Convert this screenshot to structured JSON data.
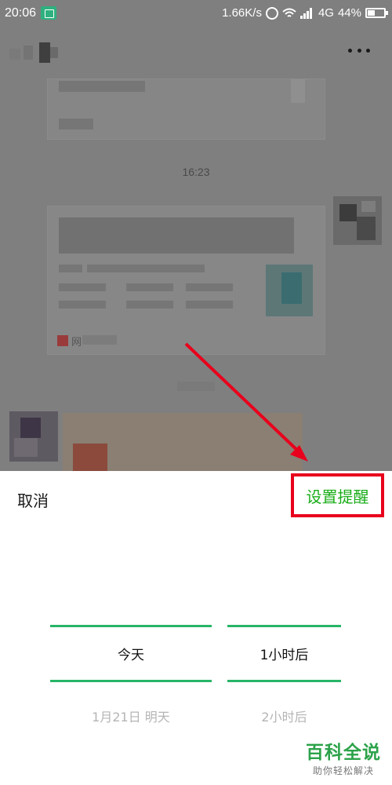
{
  "status_bar": {
    "time": "20:06",
    "net_speed": "1.66K/s",
    "network": "4G",
    "battery": "44%",
    "battery_level": 0.44
  },
  "chat": {
    "timestamp": "16:23",
    "card_source_text": "网"
  },
  "sheet": {
    "cancel_label": "取消",
    "set_reminder_label": "设置提醒",
    "day_picker": {
      "selected": "今天",
      "next": "1月21日 明天"
    },
    "time_picker": {
      "selected": "1小时后",
      "next": "2小时后"
    }
  },
  "watermark": {
    "title": "百科全说",
    "subtitle": "助你轻松解决"
  },
  "colors": {
    "accent_green": "#1aad19",
    "picker_line": "#27b567",
    "highlight_red": "#e8001c"
  }
}
